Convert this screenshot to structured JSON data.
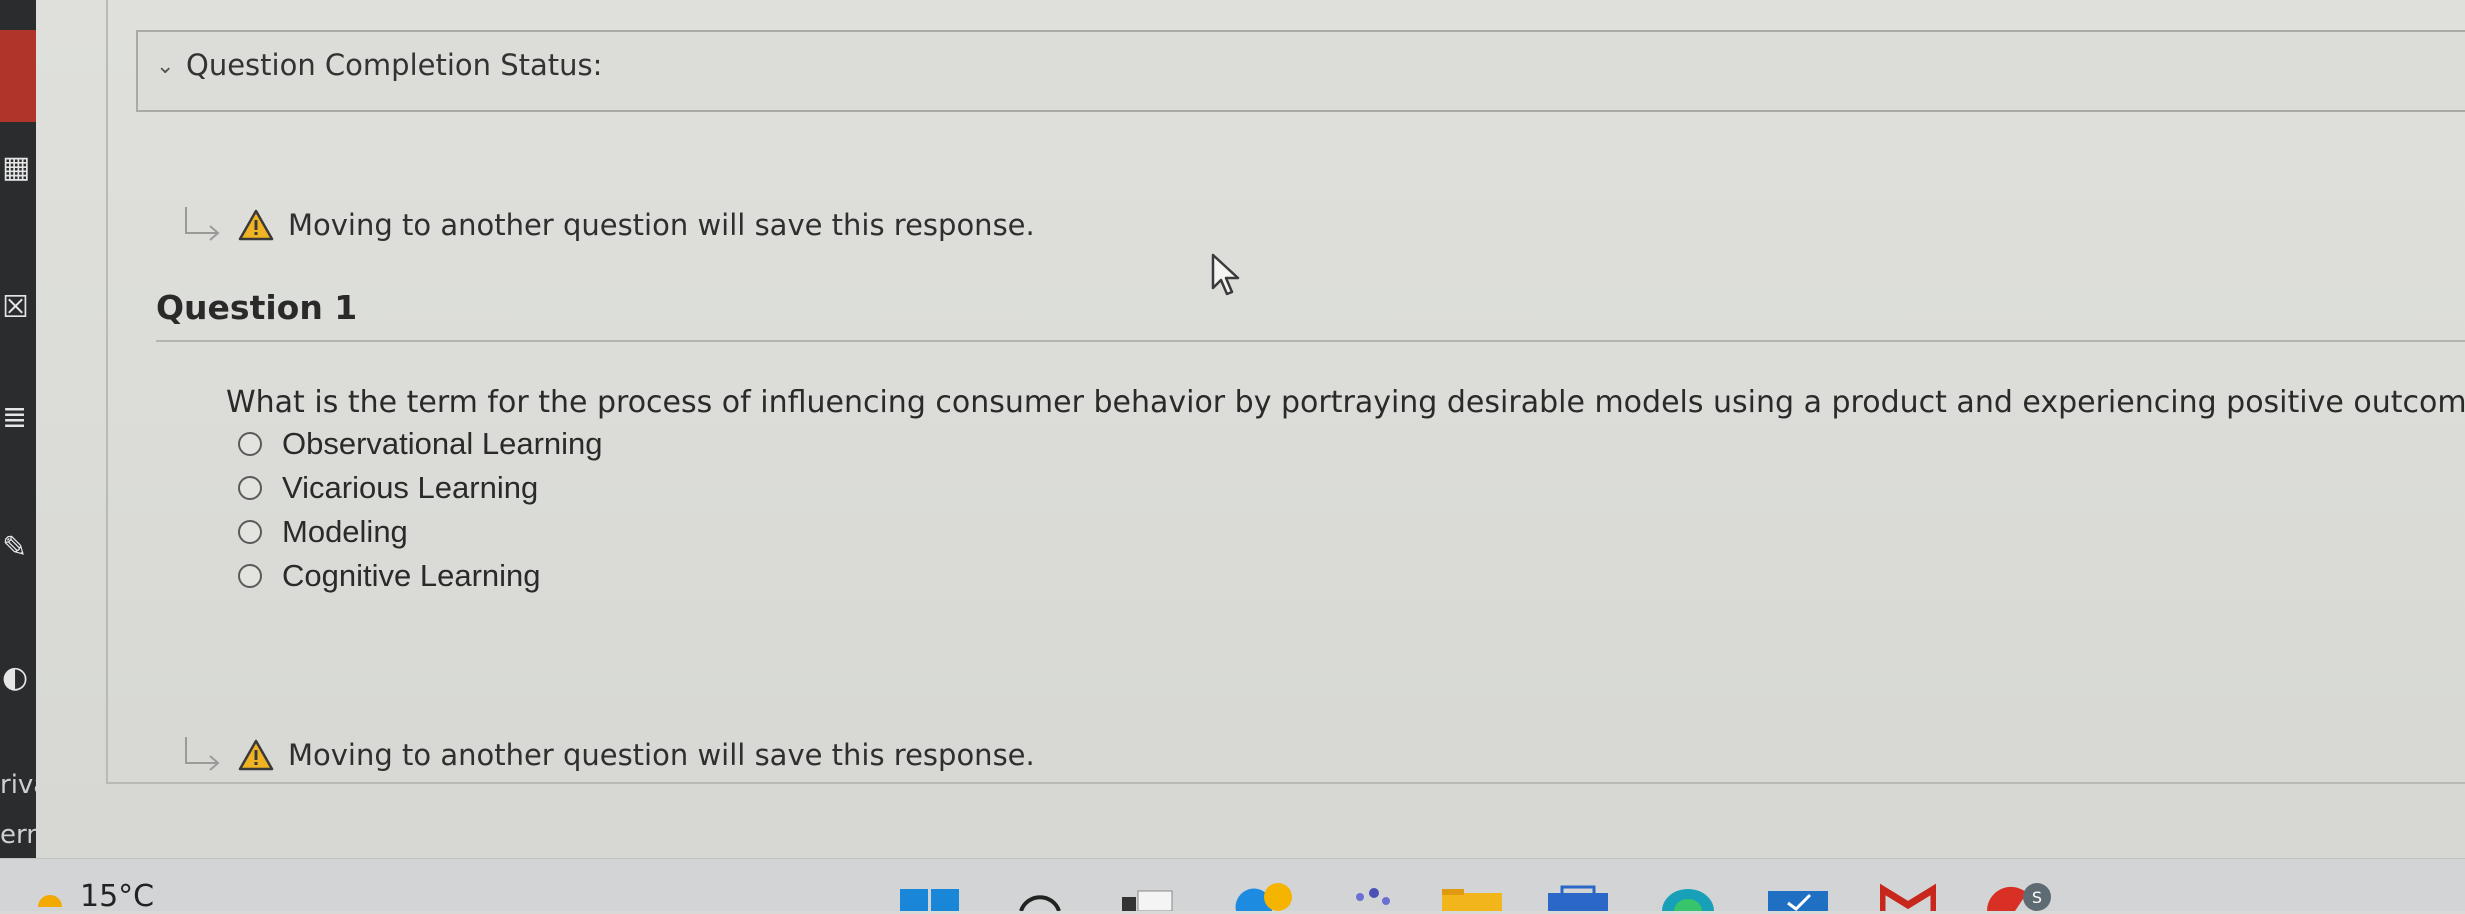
{
  "status": {
    "label": "Question Completion Status:"
  },
  "save_note": {
    "text": "Moving to another question will save this response."
  },
  "question": {
    "title": "Question 1",
    "text": "What is the term for the process of influencing consumer behavior by portraying desirable models using a product and experiencing positive outcomes?",
    "options": [
      {
        "label": "Observational Learning"
      },
      {
        "label": "Vicarious Learning"
      },
      {
        "label": "Modeling"
      },
      {
        "label": "Cognitive Learning"
      }
    ]
  },
  "left_strip": {
    "partial_text_1": "riva",
    "partial_text_2": "ern"
  },
  "taskbar": {
    "temperature": "15°C",
    "icons": [
      "windows-start-icon",
      "search-icon",
      "task-view-icon",
      "edge-icon",
      "teams-icon",
      "file-explorer-icon",
      "microsoft-store-icon",
      "edge-dev-icon",
      "todo-icon",
      "gmail-icon",
      "chrome-icon"
    ]
  },
  "colors": {
    "warning": "#f0b323",
    "sidebar_red": "#b0342a",
    "sidebar_dark": "#2b2c2e"
  }
}
